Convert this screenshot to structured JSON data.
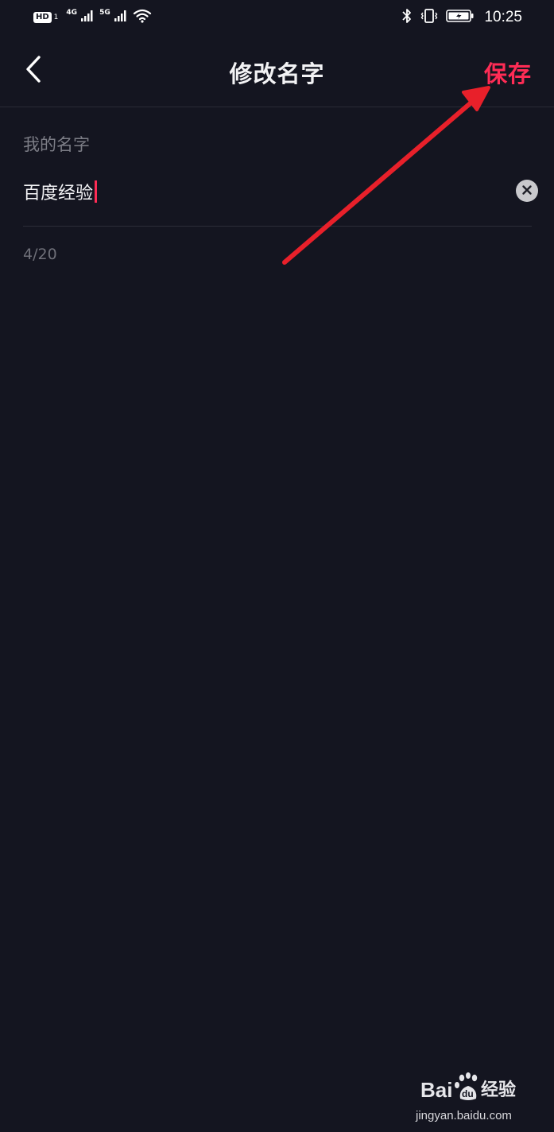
{
  "status_bar": {
    "hd_badge": "HD",
    "hd_sub": "1",
    "net1_label": "4G",
    "net2_label": "5G",
    "time": "10:25",
    "icons": [
      "signal-icon",
      "wifi-icon",
      "bluetooth-icon",
      "vibrate-icon",
      "battery-icon"
    ]
  },
  "header": {
    "title": "修改名字",
    "save_label": "保存",
    "back_icon": "chevron-left-icon"
  },
  "form": {
    "label": "我的名字",
    "name_value": "百度经验",
    "clear_icon": "clear-icon",
    "char_count": "4/20"
  },
  "watermark": {
    "logo_text": "Baidu经验",
    "url": "jingyan.baidu.com"
  },
  "colors": {
    "background": "#141520",
    "accent": "#fe2c55",
    "annotation_arrow": "#e8202a"
  }
}
